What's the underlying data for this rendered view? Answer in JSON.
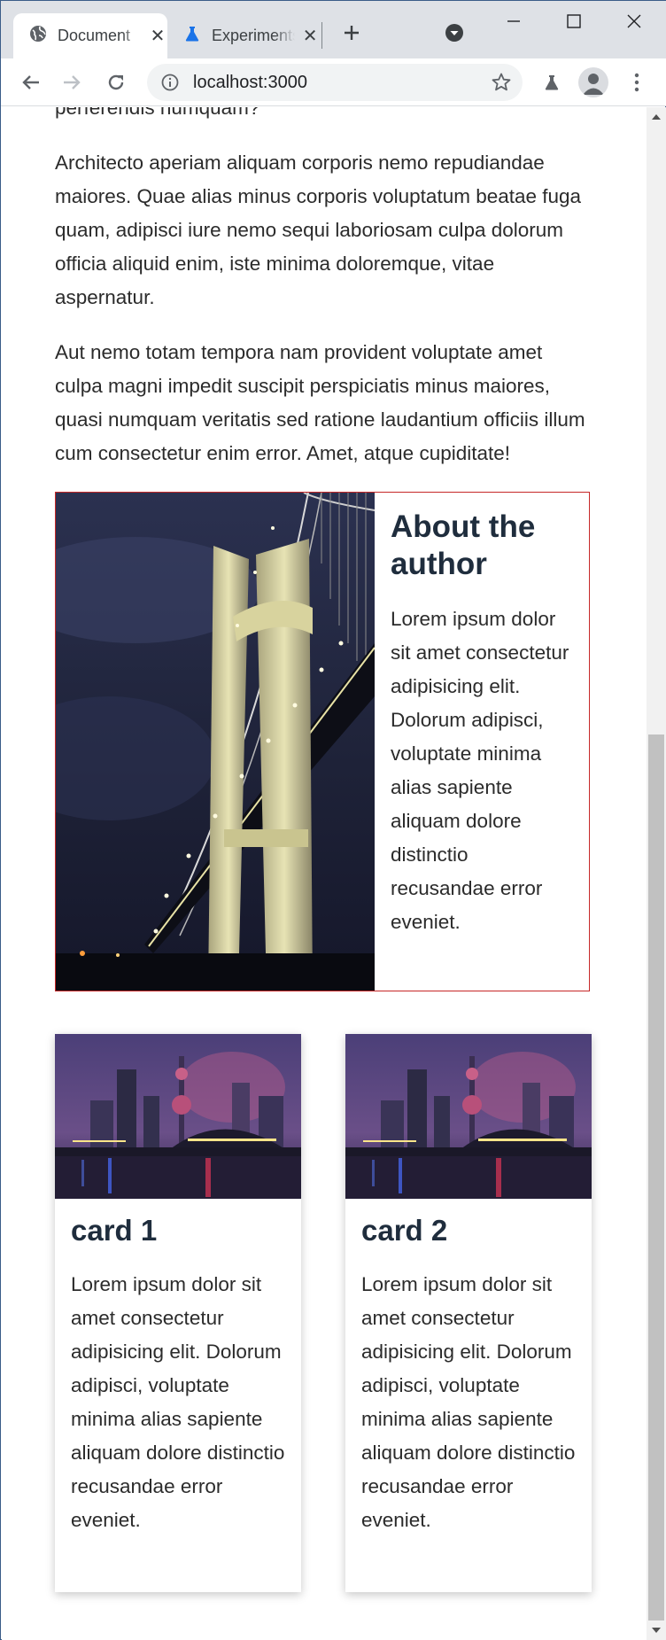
{
  "browser": {
    "tabs": [
      {
        "title": "Document",
        "active": true
      },
      {
        "title": "Experiments",
        "active": false
      }
    ],
    "url": "localhost:3000"
  },
  "page": {
    "paragraphs": [
      "perferendis numquam?",
      "Architecto aperiam aliquam corporis nemo repudiandae maiores. Quae alias minus corporis voluptatum beatae fuga quam, adipisci iure nemo sequi laboriosam culpa dolorum officia aliquid enim, iste minima doloremque, vitae aspernatur.",
      "Aut nemo totam tempora nam provident voluptate amet culpa magni impedit suscipit perspiciatis minus maiores, quasi numquam veritatis sed ratione laudantium officiis illum cum consectetur enim error. Amet, atque cupiditate!"
    ],
    "author": {
      "heading": "About the author",
      "body": "Lorem ipsum dolor sit amet consectetur adipisicing elit. Dolorum adipisci, voluptate minima alias sapiente aliquam dolore distinctio recusandae error eveniet."
    },
    "cards": [
      {
        "title": "card 1",
        "body": "Lorem ipsum dolor sit amet consectetur adipisicing elit. Dolorum adipisci, voluptate minima alias sapiente aliquam dolore distinctio recusandae error eveniet."
      },
      {
        "title": "card 2",
        "body": "Lorem ipsum dolor sit amet consectetur adipisicing elit. Dolorum adipisci, voluptate minima alias sapiente aliquam dolore distinctio recusandae error eveniet."
      }
    ]
  },
  "colors": {
    "accent_border": "#c62828",
    "heading": "#1f2d3d",
    "tabstrip": "#dee1e6",
    "experiments_icon": "#1a73e8"
  }
}
